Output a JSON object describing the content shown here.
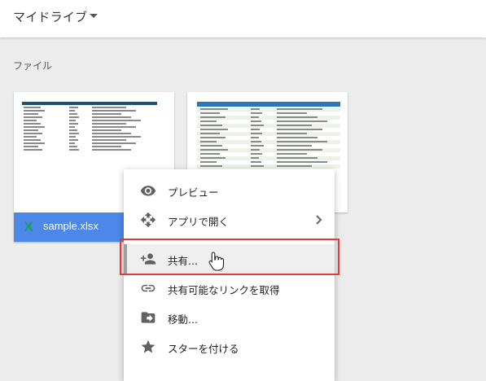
{
  "header": {
    "title": "マイドライブ",
    "caret_icon": "caret-down-icon"
  },
  "section": {
    "label": "ファイル"
  },
  "files": [
    {
      "name": "sample.xlsx",
      "icon": "excel-icon",
      "icon_letter": "X",
      "footer_color": "#4b88e8"
    },
    {
      "name": "",
      "icon": "spreadsheet-thumbnail"
    }
  ],
  "context_menu": {
    "items": [
      {
        "label": "プレビュー",
        "icon": "eye-icon"
      },
      {
        "label": "アプリで開く",
        "icon": "move-arrows-icon",
        "submenu_icon": "chevron-right-icon"
      },
      {
        "label": "共有...",
        "icon": "add-person-icon",
        "active": true
      },
      {
        "label": "共有可能なリンクを取得",
        "icon": "link-icon"
      },
      {
        "label": "移動...",
        "icon": "folder-move-icon"
      },
      {
        "label": "スターを付ける",
        "icon": "star-icon"
      }
    ]
  },
  "annotation": {
    "highlight_color": "#e53935"
  },
  "cursor": {
    "icon": "hand-pointer-icon"
  }
}
